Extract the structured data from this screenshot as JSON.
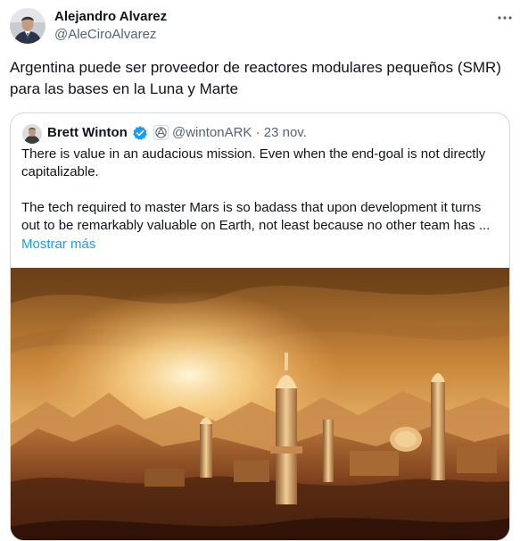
{
  "tweet": {
    "author_name": "Alejandro Alvarez",
    "author_handle": "@AleCiroAlvarez",
    "more_icon": "more-horizontal-icon",
    "text": "Argentina puede ser proveedor de reactores modulares pequeños (SMR) para las bases en la Luna y Marte"
  },
  "quote": {
    "author_name": "Brett Winton",
    "handle_date": "@wintonARK · 23 nov.",
    "verified_icon": "verified-badge-icon",
    "affiliation_icon": "ark-affiliation-icon",
    "paragraph_1": "There is value in an audacious mission. Even when the end-goal is not directly capitalizable.",
    "paragraph_2": "The tech required to master Mars is so badass that upon development it turns out to be remarkably valuable on Earth, not least because no other team has ...",
    "show_more": "Mostrar más",
    "media": "mars-colony-image"
  },
  "colors": {
    "text": "#0f1419",
    "secondary": "#536471",
    "link": "#1d9bf0",
    "border": "#cfd9de"
  }
}
